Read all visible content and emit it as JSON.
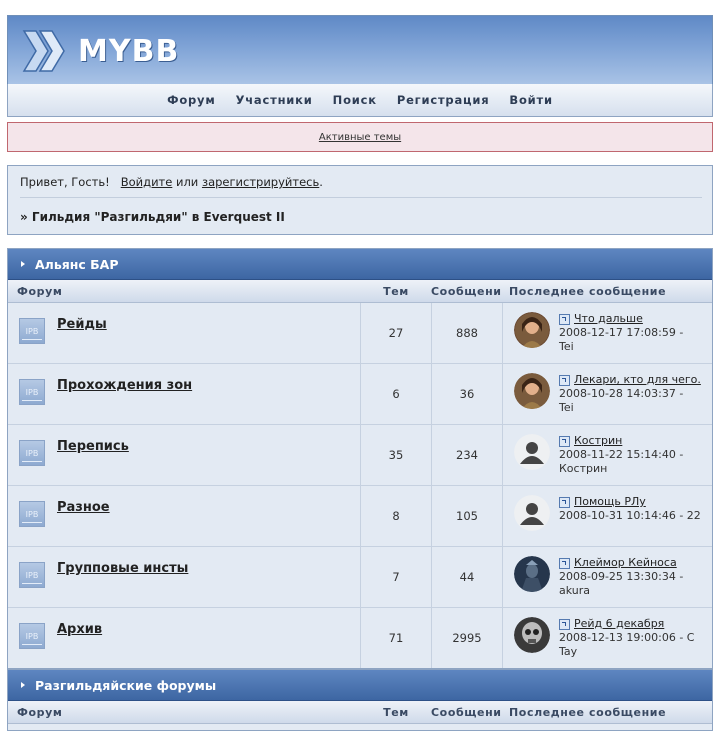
{
  "header": {
    "logo_text": "MYBB"
  },
  "nav": {
    "items": [
      "Форум",
      "Участники",
      "Поиск",
      "Регистрация",
      "Войти"
    ]
  },
  "notice": {
    "link": "Активные темы"
  },
  "welcome": {
    "greeting": "Привет, Гость!",
    "login_link": "Войдите",
    "or_text": "или",
    "register_link": "зарегистрируйтесь",
    "end_text": ".",
    "breadcrumb": "» Гильдия \"Разгильдяи\" в Everquest II"
  },
  "columns": {
    "forum": "Форум",
    "topics": "Тем",
    "posts": "Сообщений",
    "last": "Последнее сообщение"
  },
  "categories": [
    {
      "title": "Альянс БАР",
      "forums": [
        {
          "name": "Рейды",
          "topics": "27",
          "posts": "888",
          "last_title": "Что дальше",
          "last_date": "2008-12-17 17:08:59 -",
          "last_author": "Tei",
          "avatar": "avatar-woman"
        },
        {
          "name": "Прохождения зон",
          "topics": "6",
          "posts": "36",
          "last_title": "Лекари, кто для чего.",
          "last_date": "2008-10-28 14:03:37 -",
          "last_author": "Tei",
          "avatar": "avatar-woman"
        },
        {
          "name": "Перепись",
          "topics": "35",
          "posts": "234",
          "last_title": "Кострин",
          "last_date": "2008-11-22 15:14:40 -",
          "last_author": "Кострин",
          "avatar": "avatar-default"
        },
        {
          "name": "Разное",
          "topics": "8",
          "posts": "105",
          "last_title": "Помощь РЛу",
          "last_date": "2008-10-31 10:14:46 - 22",
          "last_author": "",
          "avatar": "avatar-default"
        },
        {
          "name": "Групповые инсты",
          "topics": "7",
          "posts": "44",
          "last_title": "Клеймор Кейноса",
          "last_date": "2008-09-25 13:30:34 -",
          "last_author": "akura",
          "avatar": "avatar-knight"
        },
        {
          "name": "Архив",
          "topics": "71",
          "posts": "2995",
          "last_title": "Рейд 6 декабря",
          "last_date": "2008-12-13 19:00:06 - С",
          "last_author": "Tay",
          "avatar": "avatar-skull"
        }
      ]
    },
    {
      "title": "Разгильдяйские форумы"
    }
  ],
  "colors": {
    "header_blue": "#5f89c6",
    "category_blue": "#3d66a3",
    "notice_bg": "#f4e5ea",
    "panel_bg": "#e3eaf3"
  }
}
